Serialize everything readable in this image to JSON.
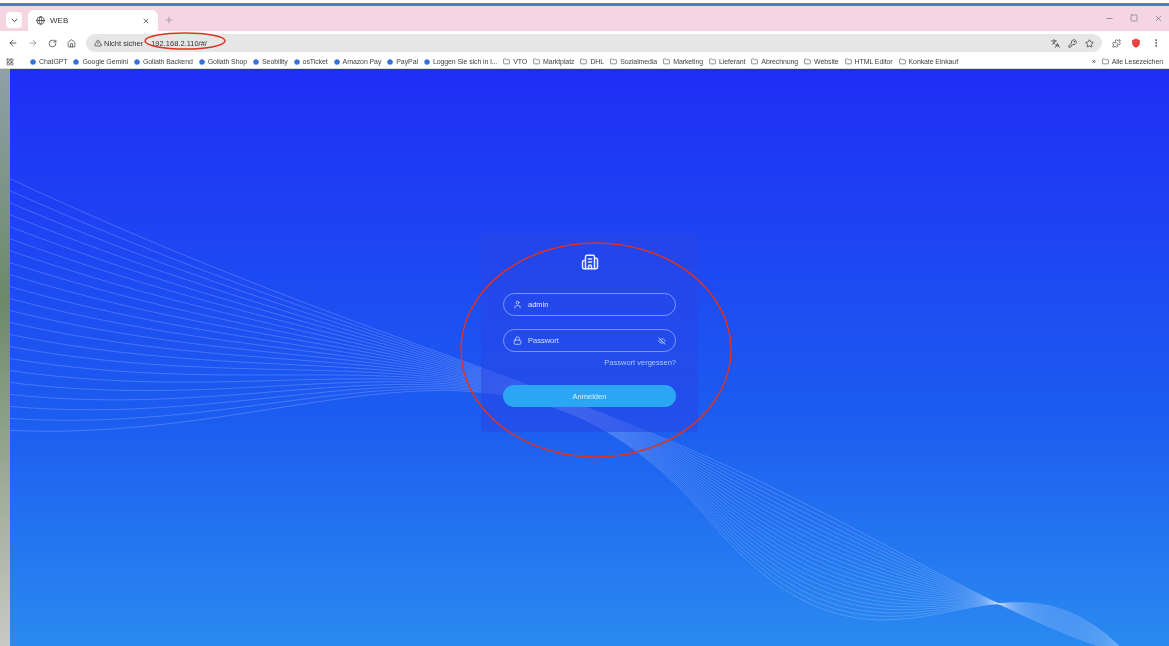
{
  "tabs": [
    {
      "title": "WEB",
      "selected": true
    }
  ],
  "address": {
    "security": "Nicht sicher",
    "url": "192.168.2.110/#/"
  },
  "bookmarks": [
    {
      "label": "ChatGPT",
      "kind": "site"
    },
    {
      "label": "Google Gemini",
      "kind": "site"
    },
    {
      "label": "Goliath Backend",
      "kind": "site"
    },
    {
      "label": "Goliath Shop",
      "kind": "site"
    },
    {
      "label": "Seobility",
      "kind": "site"
    },
    {
      "label": "osTicket",
      "kind": "site"
    },
    {
      "label": "Amazon Pay",
      "kind": "site"
    },
    {
      "label": "PayPal",
      "kind": "site"
    },
    {
      "label": "Loggen Sie sich in l...",
      "kind": "site"
    },
    {
      "label": "VTO",
      "kind": "folder"
    },
    {
      "label": "Marktplatz",
      "kind": "folder"
    },
    {
      "label": "DHL",
      "kind": "folder"
    },
    {
      "label": "Sozialmedia",
      "kind": "folder"
    },
    {
      "label": "Marketing",
      "kind": "folder"
    },
    {
      "label": "Lieferant",
      "kind": "folder"
    },
    {
      "label": "Abrechnung",
      "kind": "folder"
    },
    {
      "label": "Website",
      "kind": "folder"
    },
    {
      "label": "HTML Editor",
      "kind": "folder"
    },
    {
      "label": "Konkate Einkauf",
      "kind": "folder"
    }
  ],
  "bookmarks_more": "»",
  "all_bookmarks": "Alle Lesezeichen",
  "login": {
    "username": "admin",
    "password_placeholder": "Passwort",
    "forgot": "Passwort vergessen?",
    "submit": "Anmelden"
  }
}
